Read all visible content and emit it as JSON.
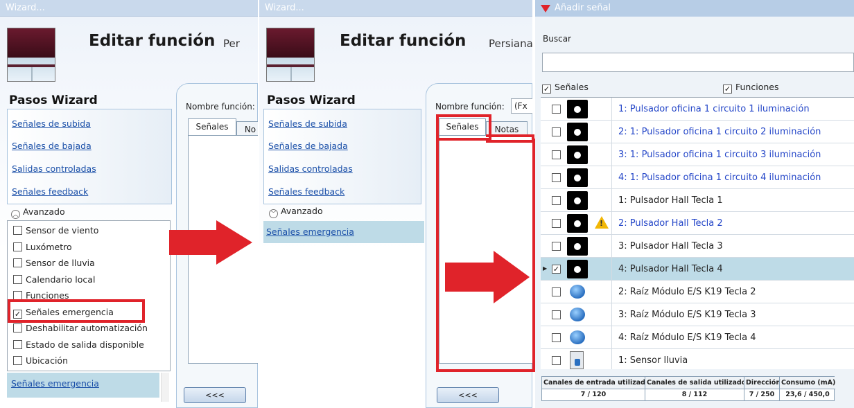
{
  "panel1": {
    "window_title": "Wizard...",
    "title": "Editar función",
    "subtitle": "Per",
    "steps_heading": "Pasos Wizard",
    "steps": [
      "Señales de subida",
      "Señales de bajada",
      "Salidas controladas",
      "Señales feedback"
    ],
    "advanced_label": "Avanzado",
    "advanced_options": [
      {
        "label": "Sensor de viento",
        "checked": ""
      },
      {
        "label": "Luxómetro",
        "checked": ""
      },
      {
        "label": "Sensor de lluvia",
        "checked": ""
      },
      {
        "label": "Calendario local",
        "checked": ""
      },
      {
        "label": "Funciones",
        "checked": ""
      },
      {
        "label": "Señales emergencia",
        "checked": "✓"
      },
      {
        "label": "Deshabilitar automatización",
        "checked": ""
      },
      {
        "label": "Estado de salida disponible",
        "checked": ""
      },
      {
        "label": "Ubicación",
        "checked": ""
      }
    ],
    "selected_step": "Señales emergencia",
    "function_name_label": "Nombre función:",
    "tabs": [
      "Señales",
      "No"
    ],
    "back_button": "<<<"
  },
  "panel2": {
    "window_title": "Wizard...",
    "title": "Editar función",
    "subtitle": "Persiana",
    "steps_heading": "Pasos Wizard",
    "steps": [
      "Señales de subida",
      "Señales de bajada",
      "Salidas controladas",
      "Señales feedback"
    ],
    "advanced_label": "Avanzado",
    "selected_step": "Señales emergencia",
    "function_name_label": "Nombre función:",
    "function_name_value": "(Fx",
    "tabs": [
      "Señales",
      "Notas"
    ],
    "back_button": "<<<"
  },
  "panel3": {
    "window_title": "Añadir señal",
    "search_label": "Buscar",
    "search_value": "",
    "filter_signals": "Señales",
    "filter_functions": "Funciones",
    "rows": [
      {
        "text": "1: Pulsador oficina 1 circuito 1 iluminación",
        "checked": "",
        "icon": "pushbutton-icon",
        "color": "blue"
      },
      {
        "text": "2: 1: Pulsador oficina 1 circuito 2 iluminación",
        "checked": "",
        "icon": "pushbutton-icon",
        "color": "blue"
      },
      {
        "text": "3: 1: Pulsador oficina 1 circuito 3 iluminación",
        "checked": "",
        "icon": "pushbutton-icon",
        "color": "blue"
      },
      {
        "text": "4: 1: Pulsador oficina 1 circuito 4 iluminación",
        "checked": "",
        "icon": "pushbutton-icon",
        "color": "blue"
      },
      {
        "text": "1: Pulsador Hall Tecla 1",
        "checked": "",
        "icon": "pushbutton-icon",
        "color": "black"
      },
      {
        "text": "2: Pulsador Hall Tecla 2",
        "checked": "",
        "icon": "pushbutton-icon",
        "color": "blue",
        "warning": "warning-icon"
      },
      {
        "text": "3: Pulsador Hall Tecla 3",
        "checked": "",
        "icon": "pushbutton-icon",
        "color": "black"
      },
      {
        "text": "4: Pulsador Hall Tecla 4",
        "checked": "✓",
        "icon": "pushbutton-icon",
        "color": "black",
        "selected": true
      },
      {
        "text": "2: Raíz Módulo E/S K19 Tecla 2",
        "checked": "",
        "icon": "blue-button-icon",
        "color": "black"
      },
      {
        "text": "3: Raíz Módulo E/S K19 Tecla 3",
        "checked": "",
        "icon": "blue-button-icon",
        "color": "black"
      },
      {
        "text": "4: Raíz Módulo E/S K19 Tecla 4",
        "checked": "",
        "icon": "blue-button-icon",
        "color": "black"
      },
      {
        "text": "1: Sensor lluvia",
        "checked": "",
        "icon": "sensor-icon",
        "color": "black"
      }
    ],
    "footer": {
      "headers": [
        "Canales de entrada utilizados",
        "Canales de salida utilizados",
        "Dirección",
        "Consumo (mA)"
      ],
      "values": [
        "7 / 120",
        "8 / 112",
        "7 / 250",
        "23,6 / 450,0"
      ]
    }
  },
  "colors": {
    "highlight_red": "#e0232a",
    "link_blue": "#1a4fa8",
    "signal_blue": "#2446c8",
    "selection": "#bedbe7"
  }
}
